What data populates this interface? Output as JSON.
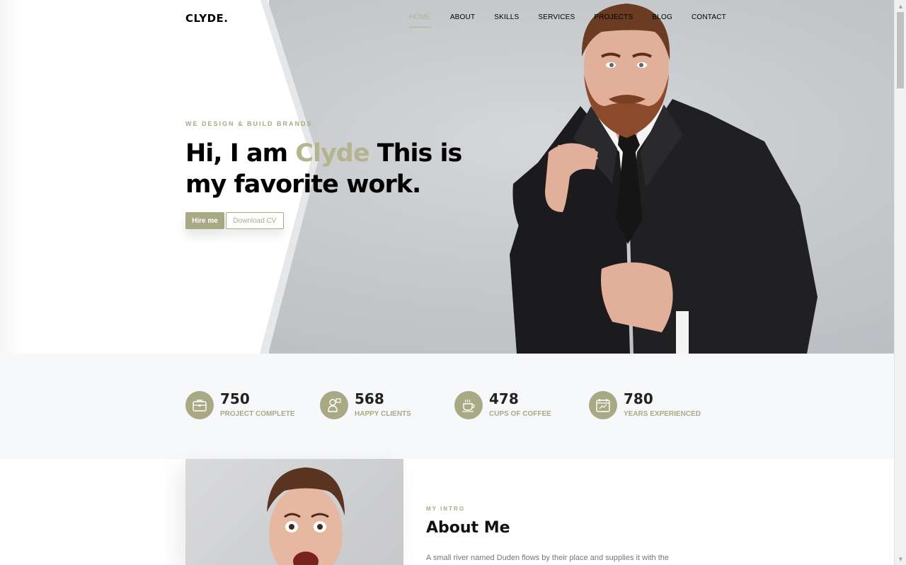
{
  "brand": {
    "logo": "CLYDE."
  },
  "nav": {
    "items": [
      {
        "label": "HOME"
      },
      {
        "label": "ABOUT"
      },
      {
        "label": "SKILLS"
      },
      {
        "label": "SERVICES"
      },
      {
        "label": "PROJECTS"
      },
      {
        "label": "BLOG"
      },
      {
        "label": "CONTACT"
      }
    ],
    "active": "HOME"
  },
  "hero": {
    "tagline": "WE DESIGN & BUILD BRANDS",
    "headline_pre": "Hi, I am ",
    "headline_accent": "Clyde",
    "headline_post": " This is my favorite work.",
    "hire_button": "Hire me",
    "cv_button": "Download CV"
  },
  "stats": [
    {
      "value": "750",
      "label": "PROJECT COMPLETE",
      "icon": "briefcase-icon"
    },
    {
      "value": "568",
      "label": "HAPPY CLIENTS",
      "icon": "client-icon"
    },
    {
      "value": "478",
      "label": "CUPS OF COFFEE",
      "icon": "coffee-icon"
    },
    {
      "value": "780",
      "label": "YEARS EXPERIENCED",
      "icon": "calendar-icon"
    }
  ],
  "about": {
    "intro_label": "MY INTRO",
    "title": "About Me",
    "text": "A small river named Duden flows by their place and supplies it with the"
  },
  "colors": {
    "accent": "#b4b48f",
    "accent_dark": "#a9a986",
    "stats_bg": "#f7f8fa"
  }
}
